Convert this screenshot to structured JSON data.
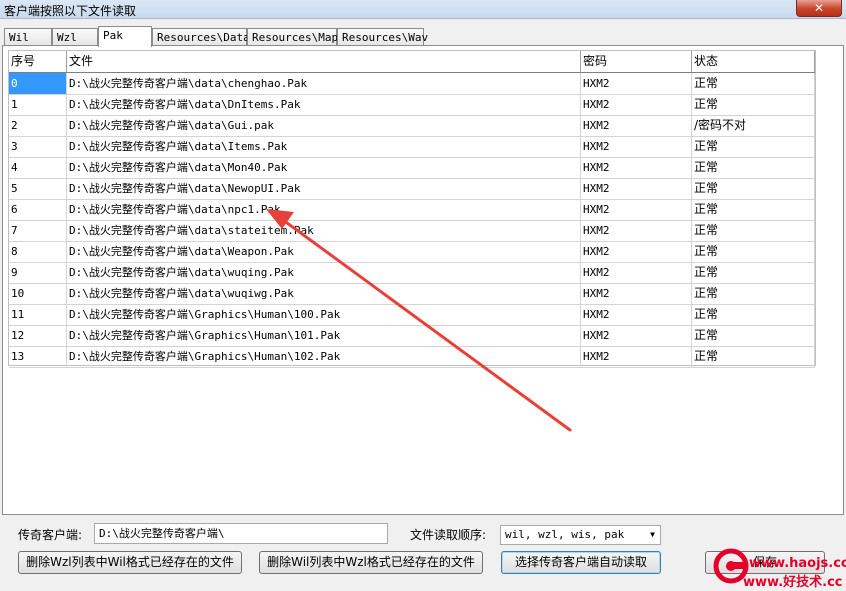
{
  "window": {
    "title": "客户端按照以下文件读取",
    "close_label": "✕"
  },
  "tabs": [
    "Wil",
    "Wzl",
    "Pak",
    "Resources\\Data",
    "Resources\\Map",
    "Resources\\Wav"
  ],
  "active_tab": "Pak",
  "table": {
    "headers": [
      "序号",
      "文件",
      "密码",
      "状态"
    ],
    "rows": [
      [
        "0",
        "D:\\战火完整传奇客户端\\data\\chenghao.Pak",
        "HXM2",
        "正常"
      ],
      [
        "1",
        "D:\\战火完整传奇客户端\\data\\DnItems.Pak",
        "HXM2",
        "正常"
      ],
      [
        "2",
        "D:\\战火完整传奇客户端\\data\\Gui.pak",
        "HXM2",
        "/密码不对"
      ],
      [
        "3",
        "D:\\战火完整传奇客户端\\data\\Items.Pak",
        "HXM2",
        "正常"
      ],
      [
        "4",
        "D:\\战火完整传奇客户端\\data\\Mon40.Pak",
        "HXM2",
        "正常"
      ],
      [
        "5",
        "D:\\战火完整传奇客户端\\data\\NewopUI.Pak",
        "HXM2",
        "正常"
      ],
      [
        "6",
        "D:\\战火完整传奇客户端\\data\\npc1.Pak",
        "HXM2",
        "正常"
      ],
      [
        "7",
        "D:\\战火完整传奇客户端\\data\\stateitem.Pak",
        "HXM2",
        "正常"
      ],
      [
        "8",
        "D:\\战火完整传奇客户端\\data\\Weapon.Pak",
        "HXM2",
        "正常"
      ],
      [
        "9",
        "D:\\战火完整传奇客户端\\data\\wuqing.Pak",
        "HXM2",
        "正常"
      ],
      [
        "10",
        "D:\\战火完整传奇客户端\\data\\wuqiwg.Pak",
        "HXM2",
        "正常"
      ],
      [
        "11",
        "D:\\战火完整传奇客户端\\Graphics\\Human\\100.Pak",
        "HXM2",
        "正常"
      ],
      [
        "12",
        "D:\\战火完整传奇客户端\\Graphics\\Human\\101.Pak",
        "HXM2",
        "正常"
      ],
      [
        "13",
        "D:\\战火完整传奇客户端\\Graphics\\Human\\102.Pak",
        "HXM2",
        "正常"
      ]
    ],
    "selected_row": 0
  },
  "client": {
    "label": "传奇客户端:",
    "value": "D:\\战火完整传奇客户端\\"
  },
  "read_order": {
    "label": "文件读取顺序:",
    "value": "wil, wzl, wis, pak"
  },
  "buttons": {
    "delete_wzl": "删除Wzl列表中Wil格式已经存在的文件",
    "delete_wil": "删除Wil列表中Wzl格式已经存在的文件",
    "auto_read": "选择传奇客户端自动读取",
    "save": "保存"
  },
  "watermark": {
    "line1": "www.haojs.cc",
    "line2": "www.好技术.cc"
  },
  "colors": {
    "selection": "#3399ff",
    "annotation_arrow": "#e8413a",
    "watermark": "#e4002b"
  }
}
